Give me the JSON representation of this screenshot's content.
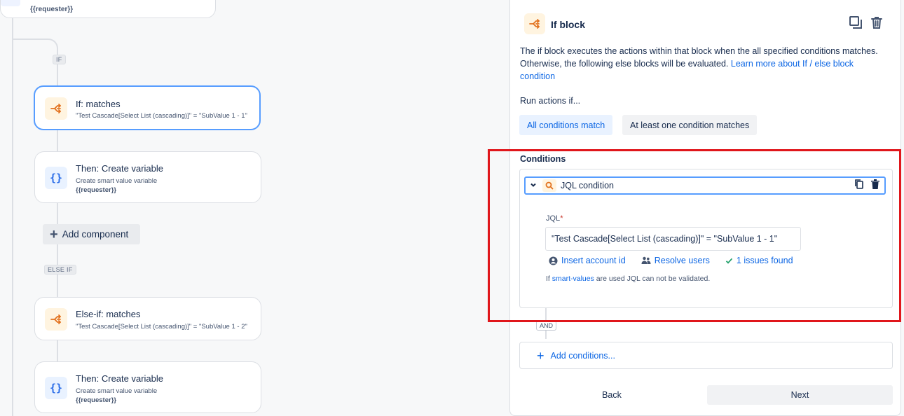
{
  "canvas": {
    "top_card": {
      "subtitle": "{{requester}}"
    },
    "branch_labels": {
      "if": "IF",
      "else_if": "ELSE IF"
    },
    "cards": [
      {
        "title": "If: matches",
        "subtitle": "\"Test Cascade[Select List (cascading)]\" = \"SubValue 1 - 1\"",
        "icon": "branch-icon"
      },
      {
        "title": "Then: Create variable",
        "subtitle": "Create smart value variable",
        "detail": "{{requester}}",
        "icon": "braces-icon"
      },
      {
        "title": "Else-if: matches",
        "subtitle": "\"Test Cascade[Select List (cascading)]\" = \"SubValue 1 - 2\"",
        "icon": "branch-icon"
      },
      {
        "title": "Then: Create variable",
        "subtitle": "Create smart value variable",
        "detail": "{{requester}}",
        "icon": "braces-icon"
      }
    ],
    "add_component_label": "Add component",
    "braces_glyph": "{}"
  },
  "panel": {
    "title": "If block",
    "description": "The if block executes the actions within that block when the all specified conditions matches. Otherwise, the following else blocks will be evaluated.",
    "learn_more_link": "Learn more about If / else block condition",
    "run_actions_label": "Run actions if...",
    "run_options": [
      "All conditions match",
      "At least one condition matches"
    ],
    "selected_run_option": "All conditions match",
    "conditions_label": "Conditions",
    "condition": {
      "title": "JQL condition",
      "jql_label": "JQL",
      "required_mark": "*",
      "jql_value": "\"Test Cascade[Select List (cascading)]\" = \"SubValue 1 - 1\"",
      "tools": {
        "insert_account_id": "Insert account id",
        "resolve_users": "Resolve users",
        "issues_found": "1 issues found"
      },
      "hint_prefix": "If",
      "hint_link": "smart-values",
      "hint_suffix": "are used JQL can not be validated."
    },
    "and_label": "AND",
    "add_conditions_label": "Add conditions...",
    "back_label": "Back",
    "next_label": "Next"
  },
  "colors": {
    "accent_blue": "#0c66e4",
    "selected_border": "#579dff",
    "highlight_red": "#e0161b",
    "branch_orange": "#e2711d"
  }
}
